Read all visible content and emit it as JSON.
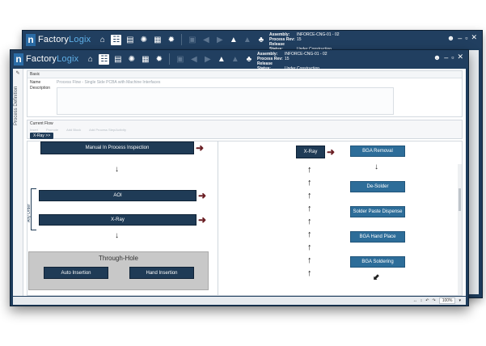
{
  "app": {
    "logo_mark": "n",
    "logo_name_a": "Factory",
    "logo_name_b": "Logix"
  },
  "back_window": {
    "assembly_label": "Assembly:",
    "assembly_value": "INFORCE-CNG-01 - 02",
    "process_rev_label": "Process Rev:",
    "process_rev_value": "15",
    "release_label": "Release Status:",
    "release_value": "Under Construction"
  },
  "front_window": {
    "assembly_label": "Assembly:",
    "assembly_value": "INFORCE-CNG-01 - 02",
    "process_rev_label": "Process Rev:",
    "process_rev_value": "15",
    "release_label": "Release Status:",
    "release_value": "Under Construction"
  },
  "toolbar_icons": [
    "home-icon",
    "route-icon",
    "document-icon",
    "network-icon",
    "report-icon",
    "gear-icon",
    "save-icon",
    "back-icon",
    "forward-icon",
    "lock-icon",
    "lock-open-icon",
    "tree-icon"
  ],
  "side_rail": {
    "label": "Process Definition"
  },
  "basic": {
    "title": "Basic",
    "name_label": "Name",
    "name_value": "Process Flow - Single Side PCBA with Machine Interfaces",
    "description_label": "Description"
  },
  "current_flow": {
    "title": "Current Flow",
    "tools": [
      "Insert",
      "Promote",
      "Add Block",
      "Add Process Step/Activity"
    ],
    "chip_label": "X-Ray >>"
  },
  "left_flow": {
    "step_manual": "Manual In Process Inspection",
    "step_aoi": "AOI",
    "step_xray": "X-Ray",
    "any_order_label": "Any Order",
    "group_title": "Through-Hole",
    "group_step_a": "Auto Insertion",
    "group_step_b": "Hand Insertion"
  },
  "right_flow": {
    "origin": "X-Ray",
    "options": [
      "BGA Removal",
      "De-Solder",
      "Solder Paste Dispense",
      "BGA Hand Place",
      "BGA Soldering"
    ]
  },
  "statusbar": {
    "zoom": "100%"
  }
}
